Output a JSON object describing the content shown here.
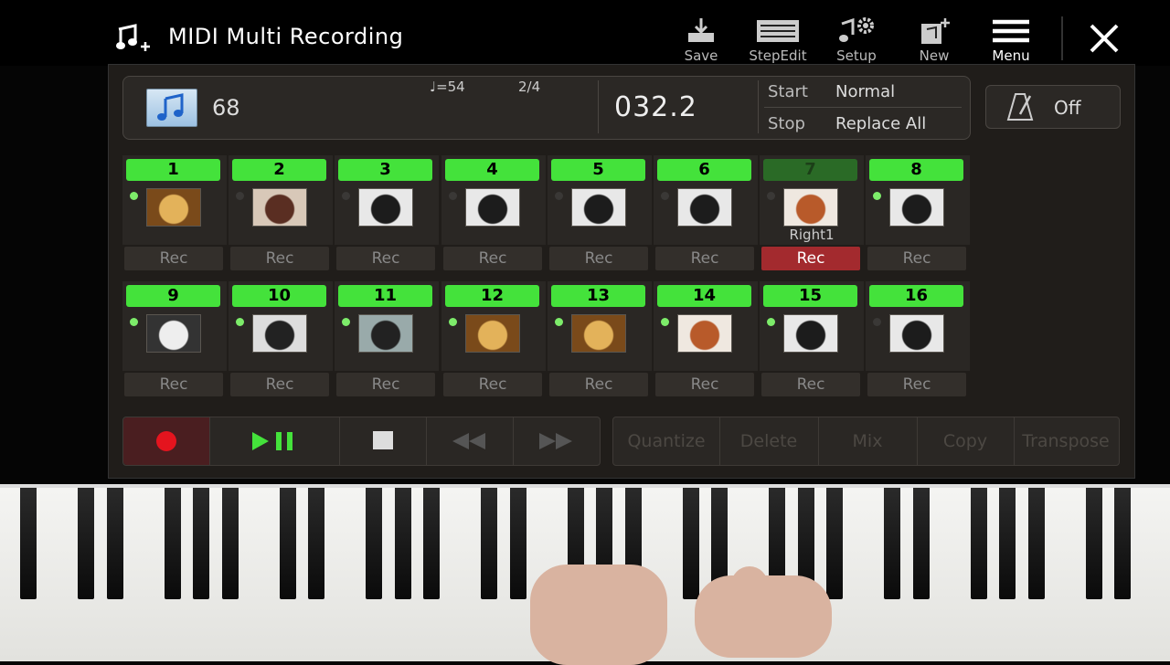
{
  "header": {
    "title": "MIDI Multi Recording",
    "toolbar": {
      "save": "Save",
      "stepedit": "StepEdit",
      "setup": "Setup",
      "new": "New",
      "menu": "Menu"
    }
  },
  "info": {
    "song_number": "68",
    "tempo": "♩=54",
    "time_signature": "2/4",
    "position": "032.2",
    "start_label": "Start",
    "start_value": "Normal",
    "stop_label": "Stop",
    "stop_value": "Replace All",
    "metronome": "Off"
  },
  "channels": [
    {
      "num": "1",
      "inst": "acoustic-guitar",
      "active": true,
      "label": "",
      "rec": "Rec",
      "rec_on": false
    },
    {
      "num": "2",
      "inst": "upright-piano",
      "active": false,
      "label": "",
      "rec": "Rec",
      "rec_on": false
    },
    {
      "num": "3",
      "inst": "grand-piano",
      "active": false,
      "label": "",
      "rec": "Rec",
      "rec_on": false
    },
    {
      "num": "4",
      "inst": "grand-piano",
      "active": false,
      "label": "",
      "rec": "Rec",
      "rec_on": false
    },
    {
      "num": "5",
      "inst": "grand-piano",
      "active": false,
      "label": "",
      "rec": "Rec",
      "rec_on": false
    },
    {
      "num": "6",
      "inst": "grand-piano",
      "active": false,
      "label": "",
      "rec": "Rec",
      "rec_on": false
    },
    {
      "num": "7",
      "inst": "synth-keyboard",
      "active": false,
      "label": "Right1",
      "rec": "Rec",
      "rec_on": true
    },
    {
      "num": "8",
      "inst": "grand-piano",
      "active": true,
      "label": "",
      "rec": "Rec",
      "rec_on": false
    },
    {
      "num": "9",
      "inst": "electronic-drums",
      "active": true,
      "label": "",
      "rec": "Rec",
      "rec_on": false
    },
    {
      "num": "10",
      "inst": "drum-kit",
      "active": true,
      "label": "",
      "rec": "Rec",
      "rec_on": false
    },
    {
      "num": "11",
      "inst": "electric-bass",
      "active": true,
      "label": "",
      "rec": "Rec",
      "rec_on": false
    },
    {
      "num": "12",
      "inst": "acoustic-guitar",
      "active": true,
      "label": "",
      "rec": "Rec",
      "rec_on": false
    },
    {
      "num": "13",
      "inst": "acoustic-guitar",
      "active": true,
      "label": "",
      "rec": "Rec",
      "rec_on": false
    },
    {
      "num": "14",
      "inst": "synth-keyboard",
      "active": true,
      "label": "",
      "rec": "Rec",
      "rec_on": false
    },
    {
      "num": "15",
      "inst": "grand-piano",
      "active": true,
      "label": "",
      "rec": "Rec",
      "rec_on": false
    },
    {
      "num": "16",
      "inst": "grand-piano",
      "active": false,
      "label": "",
      "rec": "Rec",
      "rec_on": false
    }
  ],
  "edit_buttons": [
    "Quantize",
    "Delete",
    "Mix",
    "Copy",
    "Transpose"
  ],
  "colors": {
    "channel_on": "#44e23b",
    "rec_active": "#a32a2e",
    "record_button": "#e4141e",
    "play_icon": "#44e23b"
  }
}
